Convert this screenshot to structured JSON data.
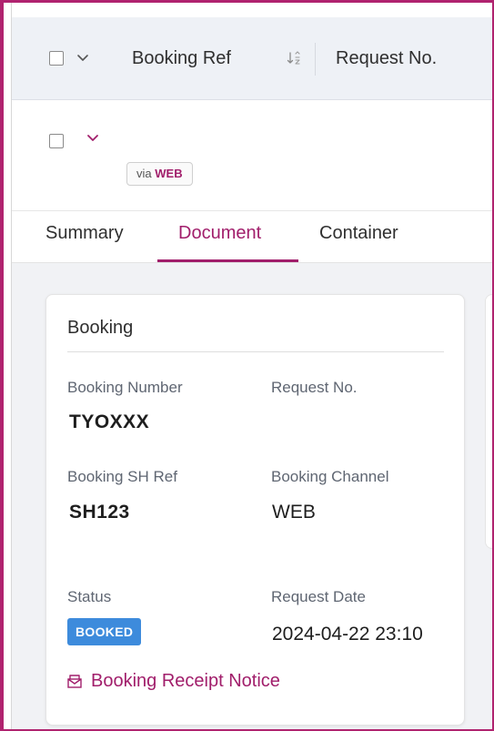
{
  "table_header": {
    "booking_ref_label": "Booking Ref",
    "request_no_label": "Request No."
  },
  "row": {
    "channel_prefix": "via",
    "channel_value": "WEB"
  },
  "tabs": [
    {
      "label": "Summary",
      "active": false
    },
    {
      "label": "Document",
      "active": true
    },
    {
      "label": "Container",
      "active": false
    }
  ],
  "booking_card": {
    "title": "Booking",
    "booking_number_label": "Booking Number",
    "booking_number_value": "TYOXXX",
    "request_no_label": "Request No.",
    "sh_ref_label": "Booking SH Ref",
    "sh_ref_value": "SH123",
    "channel_label": "Booking Channel",
    "channel_value": "WEB",
    "status_label": "Status",
    "status_value": "BOOKED",
    "request_date_label": "Request Date",
    "request_date_value": "2024-04-22 23:10",
    "receipt_link_label": "Booking Receipt Notice"
  },
  "colors": {
    "accent": "#a11e6b",
    "status_booked": "#3d8bdc",
    "header_bg": "#eef1f6",
    "content_bg": "#f1f2f5"
  }
}
